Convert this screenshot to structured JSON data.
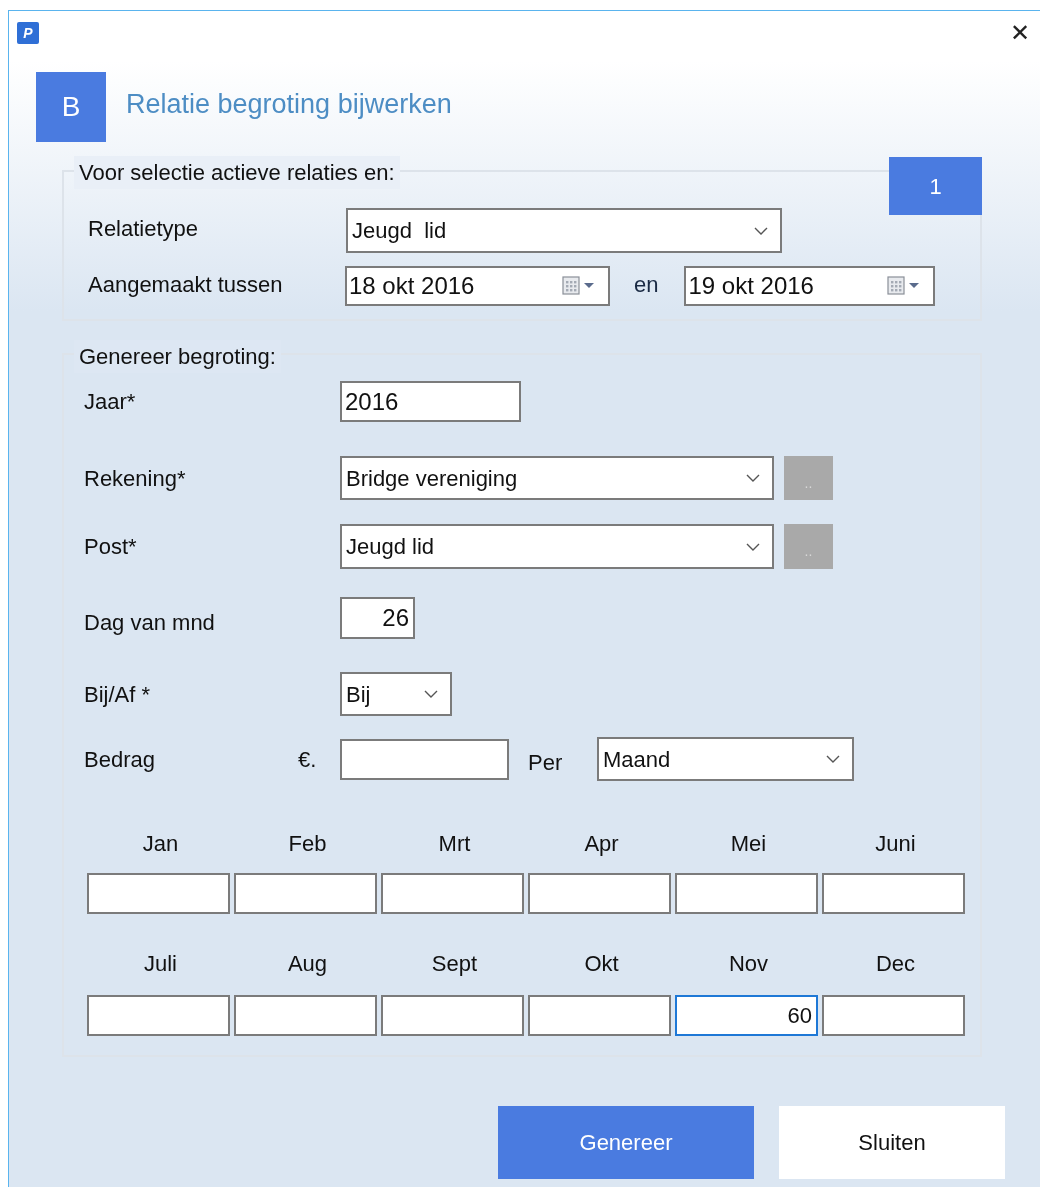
{
  "window": {
    "icon": "P",
    "close": "✕"
  },
  "header": {
    "badge": "B",
    "title": "Relatie begroting bijwerken"
  },
  "selection": {
    "legend": "Voor selectie actieve relaties en:",
    "step": "1",
    "relation_type": {
      "label": "Relatietype",
      "value": "Jeugd  lid"
    },
    "created": {
      "label": "Aangemaakt tussen",
      "from": "18 okt 2016",
      "joiner": "en",
      "to": "19 okt 2016"
    }
  },
  "generate": {
    "legend": "Genereer begroting:",
    "year": {
      "label": "Jaar*",
      "value": "2016"
    },
    "account": {
      "label": "Rekening*",
      "value": "Bridge vereniging",
      "browse": ".."
    },
    "post": {
      "label": "Post*",
      "value": "Jeugd lid",
      "browse": ".."
    },
    "day": {
      "label": "Dag van mnd",
      "value": "26"
    },
    "direction": {
      "label": "Bij/Af *",
      "value": "Bij"
    },
    "amount": {
      "label": "Bedrag",
      "currency": "€.",
      "per_label": "Per",
      "per_value": "Maand"
    },
    "months": [
      {
        "label": "Jan",
        "focused": false
      },
      {
        "label": "Feb",
        "focused": false
      },
      {
        "label": "Mrt",
        "focused": false
      },
      {
        "label": "Apr",
        "focused": false
      },
      {
        "label": "Mei",
        "focused": false
      },
      {
        "label": "Juni",
        "focused": false
      },
      {
        "label": "Juli",
        "focused": false
      },
      {
        "label": "Aug",
        "focused": false
      },
      {
        "label": "Sept",
        "focused": false
      },
      {
        "label": "Okt",
        "focused": false
      },
      {
        "label": "Nov",
        "value": "60",
        "focused": true
      },
      {
        "label": "Dec",
        "focused": false
      }
    ]
  },
  "buttons": [
    {
      "label": "Genereer",
      "primary": true
    },
    {
      "label": "Sluiten",
      "primary": false
    }
  ]
}
